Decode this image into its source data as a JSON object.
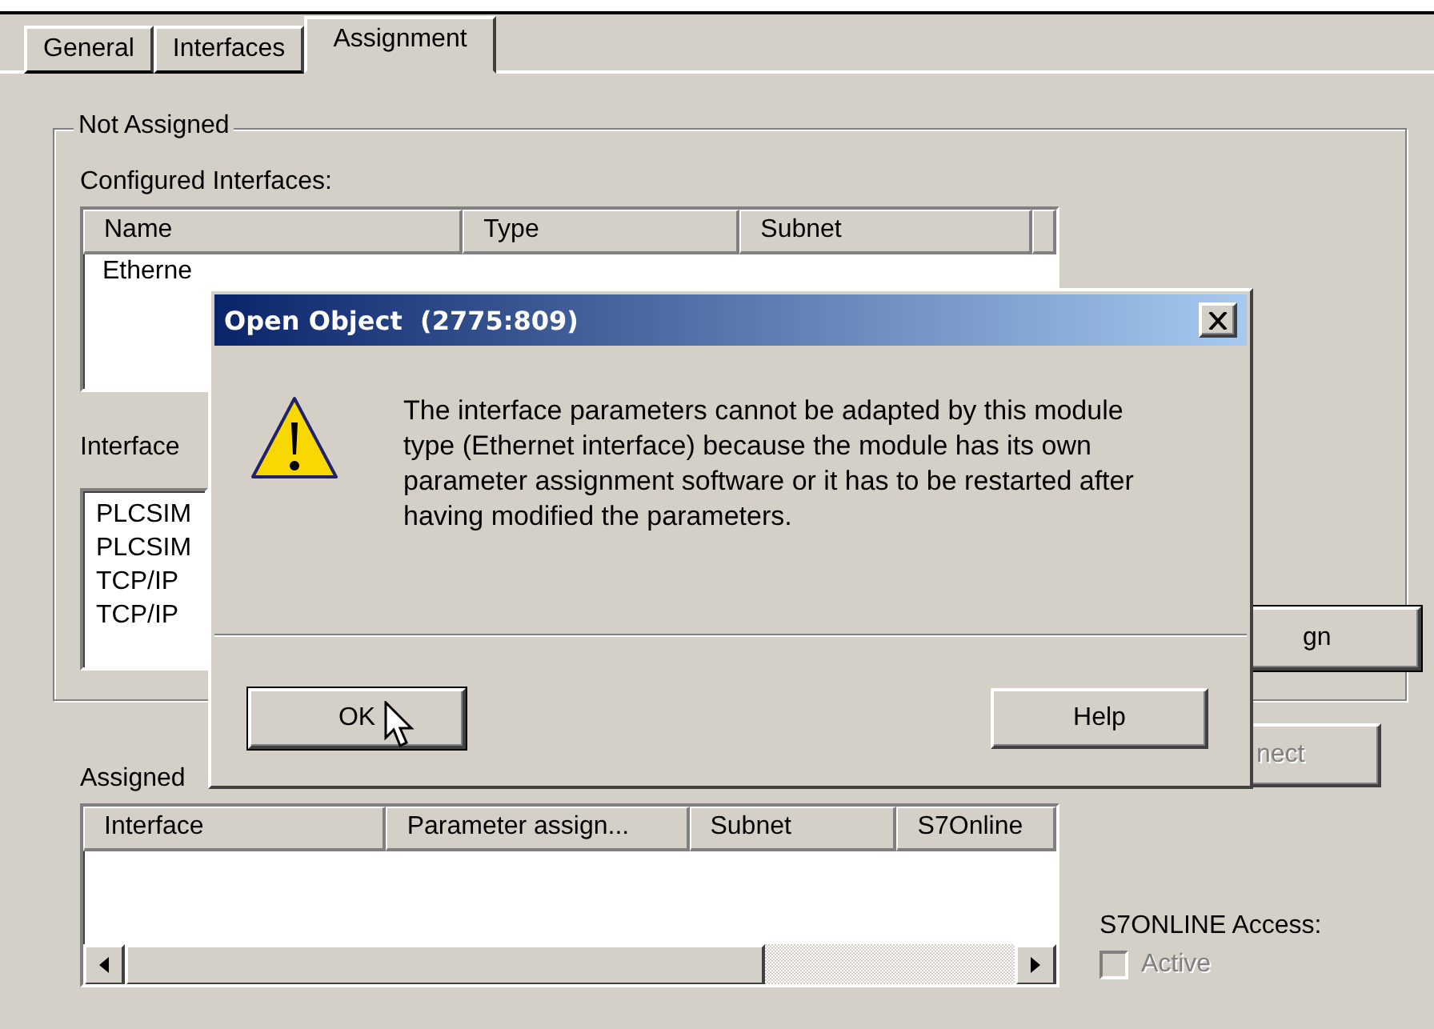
{
  "tabs": [
    {
      "label": "General",
      "selected": false
    },
    {
      "label": "Interfaces",
      "selected": false
    },
    {
      "label": "Assignment",
      "selected": true
    }
  ],
  "not_assigned": {
    "title": "Not Assigned",
    "configured_label": "Configured Interfaces:",
    "table": {
      "columns": [
        "Name",
        "Type",
        "Subnet"
      ],
      "rows": [
        [
          "Etherne"
        ]
      ]
    },
    "interface_label": "Interface",
    "interface_list": [
      "PLCSIM",
      "PLCSIM",
      "TCP/IP",
      "TCP/IP"
    ],
    "assign_button": {
      "label": "gn",
      "disabled": false
    }
  },
  "assigned": {
    "label": "Assigned",
    "table": {
      "columns": [
        "Interface",
        "Parameter assign...",
        "Subnet",
        "S7Online"
      ]
    },
    "disconnect_button": {
      "label": "nect",
      "disabled": true
    },
    "access_label": "S7ONLINE Access:",
    "active_checkbox": {
      "label": "Active",
      "checked": false,
      "disabled": true
    }
  },
  "dialog": {
    "title": "Open Object  (2775:809)",
    "message": "The interface parameters cannot be adapted by this module type (Ethernet interface) because the module has its own parameter assignment software or it has to be restarted after having modified the parameters.",
    "buttons": [
      {
        "label": "OK",
        "default": true
      },
      {
        "label": "Help",
        "default": false
      }
    ]
  }
}
